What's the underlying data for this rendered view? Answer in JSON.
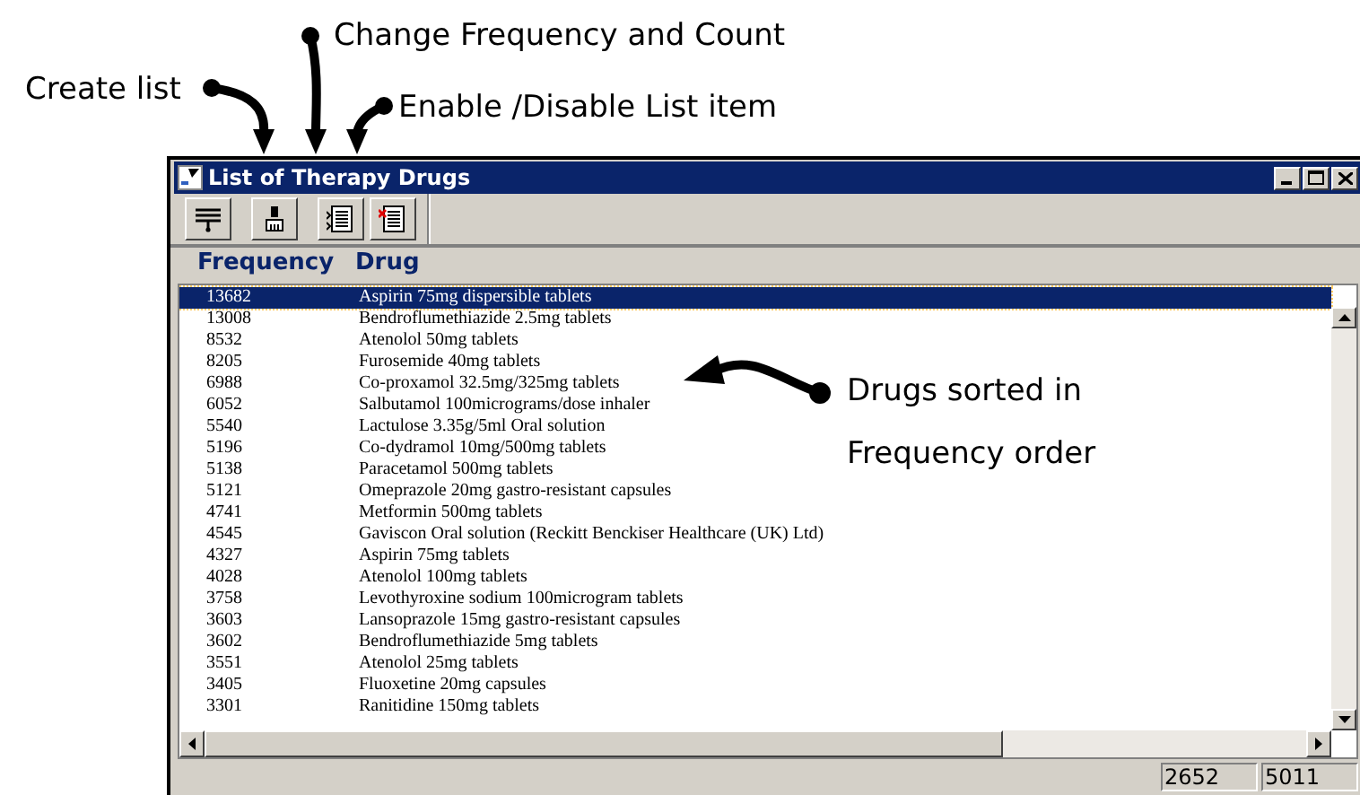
{
  "annotations": [
    {
      "kind": "label",
      "text": "Create list"
    },
    {
      "kind": "label",
      "text": "Change Frequency and Count"
    },
    {
      "kind": "label",
      "text": "Enable /Disable List item"
    },
    {
      "kind": "label",
      "text": "Drugs sorted in"
    },
    {
      "kind": "label",
      "text": "Frequency order"
    }
  ],
  "window": {
    "title": "List of Therapy Drugs"
  },
  "columns": [
    "Frequency",
    "Drug"
  ],
  "rows": [
    {
      "frequency": "13682",
      "drug": "Aspirin 75mg dispersible tablets",
      "selected": true
    },
    {
      "frequency": "13008",
      "drug": "Bendroflumethiazide 2.5mg tablets",
      "selected": false
    },
    {
      "frequency": "8532",
      "drug": "Atenolol 50mg tablets",
      "selected": false
    },
    {
      "frequency": "8205",
      "drug": "Furosemide 40mg tablets",
      "selected": false
    },
    {
      "frequency": "6988",
      "drug": "Co-proxamol 32.5mg/325mg tablets",
      "selected": false
    },
    {
      "frequency": "6052",
      "drug": "Salbutamol 100micrograms/dose inhaler",
      "selected": false
    },
    {
      "frequency": "5540",
      "drug": "Lactulose 3.35g/5ml Oral solution",
      "selected": false
    },
    {
      "frequency": "5196",
      "drug": "Co-dydramol 10mg/500mg tablets",
      "selected": false
    },
    {
      "frequency": "5138",
      "drug": "Paracetamol 500mg tablets",
      "selected": false
    },
    {
      "frequency": "5121",
      "drug": "Omeprazole 20mg gastro-resistant capsules",
      "selected": false
    },
    {
      "frequency": "4741",
      "drug": "Metformin 500mg tablets",
      "selected": false
    },
    {
      "frequency": "4545",
      "drug": "Gaviscon Oral solution (Reckitt Benckiser Healthcare (UK) Ltd)",
      "selected": false
    },
    {
      "frequency": "4327",
      "drug": "Aspirin 75mg tablets",
      "selected": false
    },
    {
      "frequency": "4028",
      "drug": "Atenolol 100mg tablets",
      "selected": false
    },
    {
      "frequency": "3758",
      "drug": "Levothyroxine sodium 100microgram tablets",
      "selected": false
    },
    {
      "frequency": "3603",
      "drug": "Lansoprazole 15mg gastro-resistant capsules",
      "selected": false
    },
    {
      "frequency": "3602",
      "drug": "Bendroflumethiazide 5mg tablets",
      "selected": false
    },
    {
      "frequency": "3551",
      "drug": "Atenolol 25mg tablets",
      "selected": false
    },
    {
      "frequency": "3405",
      "drug": "Fluoxetine 20mg capsules",
      "selected": false
    },
    {
      "frequency": "3301",
      "drug": "Ranitidine 150mg tablets",
      "selected": false
    }
  ],
  "status_bar": [
    "2652",
    "5011"
  ]
}
